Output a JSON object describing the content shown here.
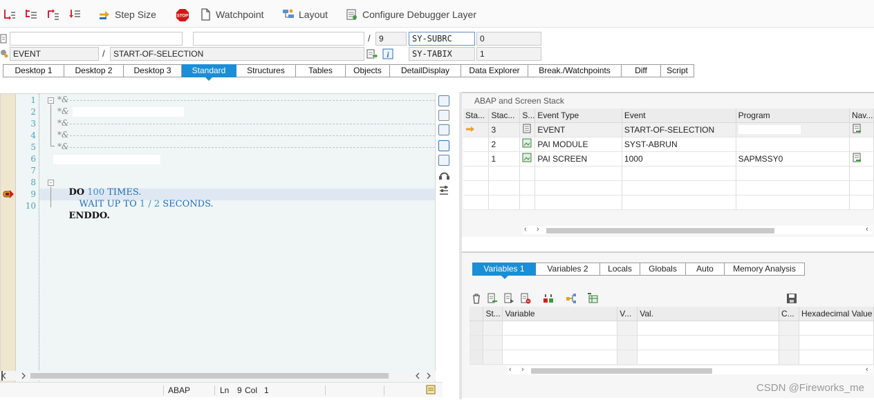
{
  "toolbar": {
    "step_size": "Step Size",
    "watchpoint": "Watchpoint",
    "layout": "Layout",
    "configure": "Configure Debugger Layer"
  },
  "fields": {
    "program_name": "",
    "include_name": "",
    "line_sep": "/",
    "line_val": "9",
    "sy_subrc_label": "SY-SUBRC",
    "sy_subrc_value": "0",
    "event_type": "EVENT",
    "event_sep": "/",
    "event_name": "START-OF-SELECTION",
    "sy_tabix_label": "SY-TABIX",
    "sy_tabix_value": "1"
  },
  "tabs": [
    {
      "label": "Desktop 1"
    },
    {
      "label": "Desktop 2"
    },
    {
      "label": "Desktop 3"
    },
    {
      "label": "Standard"
    },
    {
      "label": "Structures"
    },
    {
      "label": "Tables"
    },
    {
      "label": "Objects"
    },
    {
      "label": "DetailDisplay"
    },
    {
      "label": "Data Explorer"
    },
    {
      "label": "Break./Watchpoints"
    },
    {
      "label": "Diff"
    },
    {
      "label": "Script"
    }
  ],
  "active_tab": "Standard",
  "editor": {
    "line_numbers": [
      "1",
      "2",
      "3",
      "4",
      "5",
      "6",
      "7",
      "8",
      "9",
      "10"
    ],
    "comment_marker": "*&",
    "code": {
      "do_kw": "DO",
      "do_num": "100",
      "do_times": "TIMES.",
      "wait_kw": "WAIT UP TO",
      "wait_a": "1",
      "wait_div": "/",
      "wait_b": "2",
      "wait_unit": "SECONDS.",
      "enddo": "ENDDO."
    },
    "current_line": 9,
    "status": {
      "language": "ABAP",
      "ln_label": "Ln",
      "ln_value": "9",
      "col_label": "Col",
      "col_value": "1"
    }
  },
  "stack": {
    "title": "ABAP and Screen Stack",
    "columns": [
      "Sta...",
      "Stac...",
      "S...",
      "Event Type",
      "Event",
      "Program",
      "Nav..."
    ],
    "rows": [
      {
        "level": "3",
        "event_type": "EVENT",
        "event": "START-OF-SELECTION",
        "program": "",
        "current": true
      },
      {
        "level": "2",
        "event_type": "PAI MODULE",
        "event": "SYST-ABRUN",
        "program": "",
        "current": false
      },
      {
        "level": "1",
        "event_type": "PAI SCREEN",
        "event": "1000",
        "program": "SAPMSSY0",
        "current": false
      }
    ]
  },
  "variables": {
    "tabs": [
      {
        "label": "Variables 1"
      },
      {
        "label": "Variables 2"
      },
      {
        "label": "Locals"
      },
      {
        "label": "Globals"
      },
      {
        "label": "Auto"
      },
      {
        "label": "Memory Analysis"
      }
    ],
    "active_tab": "Variables 1",
    "columns": [
      "St...",
      "Variable",
      "V...",
      "Val.",
      "C...",
      "Hexadecimal Value"
    ]
  },
  "watermark": "CSDN @Fireworks_me",
  "colors": {
    "accent": "#1a8ed6",
    "comment": "#888888",
    "keyword": "#111111",
    "token_blue": "#1c6ec2"
  }
}
